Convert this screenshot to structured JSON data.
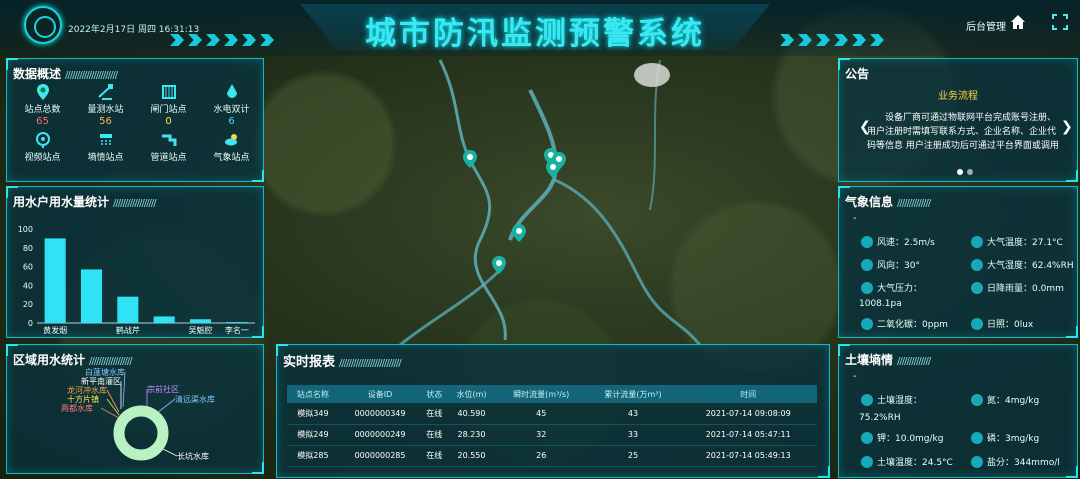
{
  "header": {
    "title": "城市防汛监测预警系统",
    "datetime": "2022年2月17日 周四 16:31:13",
    "admin_label": "后台管理"
  },
  "overview": {
    "title": "数据概述",
    "items": [
      {
        "label": "站点总数",
        "value": "65",
        "color": "#ff6b6b",
        "icon": "location-pin-icon"
      },
      {
        "label": "量测水站",
        "value": "56",
        "color": "#ffb84d",
        "icon": "water-gauge-icon"
      },
      {
        "label": "闸门站点",
        "value": "0",
        "color": "#ffe54d",
        "icon": "sluice-gate-icon"
      },
      {
        "label": "水电双计",
        "value": "6",
        "color": "#4dd8ff",
        "icon": "water-drop-icon"
      },
      {
        "label": "视频站点",
        "value": "",
        "icon": "camera-pin-icon"
      },
      {
        "label": "墒情站点",
        "value": "",
        "icon": "sprinkler-icon"
      },
      {
        "label": "管道站点",
        "value": "",
        "icon": "pipe-faucet-icon"
      },
      {
        "label": "气象站点",
        "value": "",
        "icon": "weather-icon"
      }
    ]
  },
  "usage": {
    "title": "用水户用水量统计",
    "chart_data": {
      "type": "bar",
      "categories": [
        "黄发烟",
        "",
        "鹤战芹",
        "",
        "吴魁腔",
        "李名一"
      ],
      "values": [
        90,
        57,
        28,
        7,
        4,
        1
      ],
      "ylim": [
        0,
        100
      ],
      "yticks": [
        0,
        20,
        40,
        60,
        80,
        100
      ],
      "color": "#2fe3f5"
    }
  },
  "region": {
    "title": "区域用水统计",
    "labels": [
      {
        "text": "白蓬塘水库",
        "color": "#7fc6ff"
      },
      {
        "text": "新平南灌区",
        "color": "#ffffff"
      },
      {
        "text": "龙河冲水库",
        "color": "#ff9f4d"
      },
      {
        "text": "十方片镇",
        "color": "#ffe54d"
      },
      {
        "text": "两都水库",
        "color": "#ff7a7a"
      },
      {
        "text": "宗前社区",
        "color": "#c48bff"
      },
      {
        "text": "清远渠水库",
        "color": "#7fc6ff"
      },
      {
        "text": "长坑水库",
        "color": "#ffffff"
      }
    ],
    "ring_color": "#b8f2c2"
  },
  "report": {
    "title": "实时报表",
    "columns": [
      "站点名称",
      "设备ID",
      "状态",
      "水位(m)",
      "瞬时流量(m³/s)",
      "累计流量(万m³)",
      "时间"
    ],
    "rows": [
      [
        "模拟349",
        "0000000349",
        "在线",
        "40.590",
        "45",
        "43",
        "2021-07-14 09:08:09"
      ],
      [
        "模拟249",
        "0000000249",
        "在线",
        "28.230",
        "32",
        "33",
        "2021-07-14 05:47:11"
      ],
      [
        "模拟285",
        "0000000285",
        "在线",
        "20.550",
        "26",
        "25",
        "2021-07-14 05:49:13"
      ]
    ]
  },
  "notice": {
    "title": "公告",
    "subtitle": "业务流程",
    "text": "设备厂商可通过物联网平台完成账号注册、用户注册时需填写联系方式、企业名称、企业代码等信息 用户注册成功后可通过平台界面或调用平台提供的"
  },
  "weather": {
    "title": "气象信息",
    "dash": "-",
    "items": [
      {
        "label": "风速：2.5m/s",
        "icon": "wind-speed-icon"
      },
      {
        "label": "大气温度：27.1°C",
        "icon": "thermometer-icon"
      },
      {
        "label": "风向：30°",
        "icon": "wind-direction-icon"
      },
      {
        "label": "大气湿度：62.4%RH",
        "icon": "humidity-icon"
      },
      {
        "label": "大气压力：",
        "icon": "pressure-icon"
      },
      {
        "label": "日降雨量：0.0mm",
        "icon": "rain-icon"
      },
      {
        "label": "1008.1pa",
        "icon": ""
      },
      {
        "label": "二氧化碳：0ppm",
        "icon": "co2-icon"
      },
      {
        "label": "日照：0lux",
        "icon": "sun-icon"
      }
    ]
  },
  "soil": {
    "title": "土壤墒情",
    "dash": "-",
    "items": [
      {
        "label": "土壤湿度：",
        "icon": "soil-moisture-icon"
      },
      {
        "label": "氮：4mg/kg",
        "icon": "nitrogen-icon"
      },
      {
        "label": "75.2%RH",
        "icon": ""
      },
      {
        "label": "钾：10.0mg/kg",
        "icon": "potassium-icon"
      },
      {
        "label": "磷：3mg/kg",
        "icon": "phosphorus-icon"
      },
      {
        "label": "土壤温度：24.5°C",
        "icon": "soil-temp-icon"
      },
      {
        "label": "盐分：344mmo/l",
        "icon": "salinity-icon"
      }
    ]
  }
}
